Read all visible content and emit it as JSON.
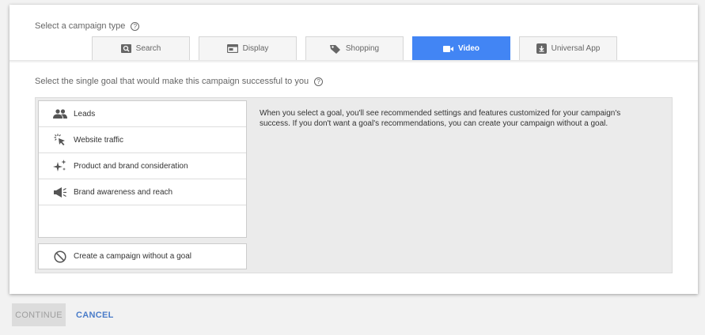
{
  "campaign_type": {
    "label": "Select a campaign type",
    "tabs": [
      {
        "label": "Search",
        "icon": "search-icon"
      },
      {
        "label": "Display",
        "icon": "display-icon"
      },
      {
        "label": "Shopping",
        "icon": "shopping-tag-icon"
      },
      {
        "label": "Video",
        "icon": "video-camera-icon",
        "active": true
      },
      {
        "label": "Universal App",
        "icon": "app-download-icon"
      }
    ]
  },
  "goal": {
    "label": "Select the single goal that would make this campaign successful to you",
    "items": [
      {
        "label": "Leads",
        "icon": "people-icon"
      },
      {
        "label": "Website traffic",
        "icon": "cursor-click-icon"
      },
      {
        "label": "Product and brand consideration",
        "icon": "sparkle-icon"
      },
      {
        "label": "Brand awareness and reach",
        "icon": "megaphone-icon"
      }
    ],
    "no_goal_label": "Create a campaign without a goal",
    "description": "When you select a goal, you'll see recommended settings and features customized for your campaign's success. If you don't want a goal's recommendations, you can create your campaign without a goal."
  },
  "actions": {
    "continue_label": "CONTINUE",
    "cancel_label": "CANCEL"
  },
  "colors": {
    "accent": "#4285f4",
    "link": "#4a7cc9"
  }
}
